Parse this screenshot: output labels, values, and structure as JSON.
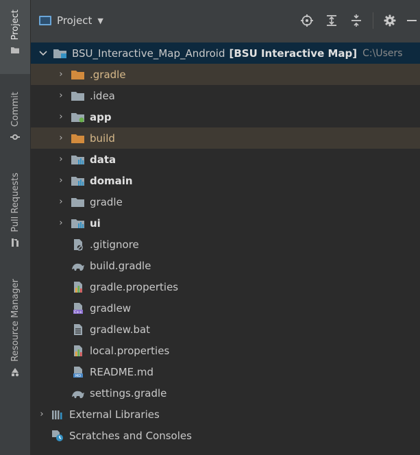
{
  "strip": {
    "tabs": [
      {
        "label": "Project",
        "icon": "folder-icon"
      },
      {
        "label": "Commit",
        "icon": "commit-icon"
      },
      {
        "label": "Pull Requests",
        "icon": "pull-request-icon"
      },
      {
        "label": "Resource Manager",
        "icon": "resource-manager-icon"
      }
    ]
  },
  "header": {
    "title": "Project",
    "tools": [
      "locate-icon",
      "expand-all-icon",
      "collapse-all-icon",
      "gear-icon",
      "minimize-icon"
    ]
  },
  "tree": {
    "root": {
      "name": "BSU_Interactive_Map_Android",
      "module": "[BSU Interactive Map]",
      "path": "C:\\Users"
    },
    "items": [
      {
        "name": ".gradle",
        "type": "folder-excluded",
        "expandable": true
      },
      {
        "name": ".idea",
        "type": "folder",
        "expandable": true
      },
      {
        "name": "app",
        "type": "module-app",
        "expandable": true,
        "bold": true
      },
      {
        "name": "build",
        "type": "folder-excluded",
        "expandable": true
      },
      {
        "name": "data",
        "type": "module-lib",
        "expandable": true,
        "bold": true
      },
      {
        "name": "domain",
        "type": "module-lib",
        "expandable": true,
        "bold": true
      },
      {
        "name": "gradle",
        "type": "folder",
        "expandable": true
      },
      {
        "name": "ui",
        "type": "module-lib",
        "expandable": true,
        "bold": true
      },
      {
        "name": ".gitignore",
        "type": "gitignore-file"
      },
      {
        "name": "build.gradle",
        "type": "gradle-file"
      },
      {
        "name": "gradle.properties",
        "type": "properties-file"
      },
      {
        "name": "gradlew",
        "type": "shell-file"
      },
      {
        "name": "gradlew.bat",
        "type": "text-file"
      },
      {
        "name": "local.properties",
        "type": "properties-file"
      },
      {
        "name": "README.md",
        "type": "markdown-file"
      },
      {
        "name": "settings.gradle",
        "type": "gradle-file"
      }
    ],
    "external_libraries": "External Libraries",
    "scratches": "Scratches and Consoles"
  },
  "colors": {
    "background": "#2b2b2b",
    "panel": "#3c3f41",
    "root_selection": "#0d293e",
    "excluded_row": "#3f3a33",
    "excluded_folder": "#d38b3d",
    "folder": "#9aa7b0",
    "module_accent": "#3592c4"
  }
}
